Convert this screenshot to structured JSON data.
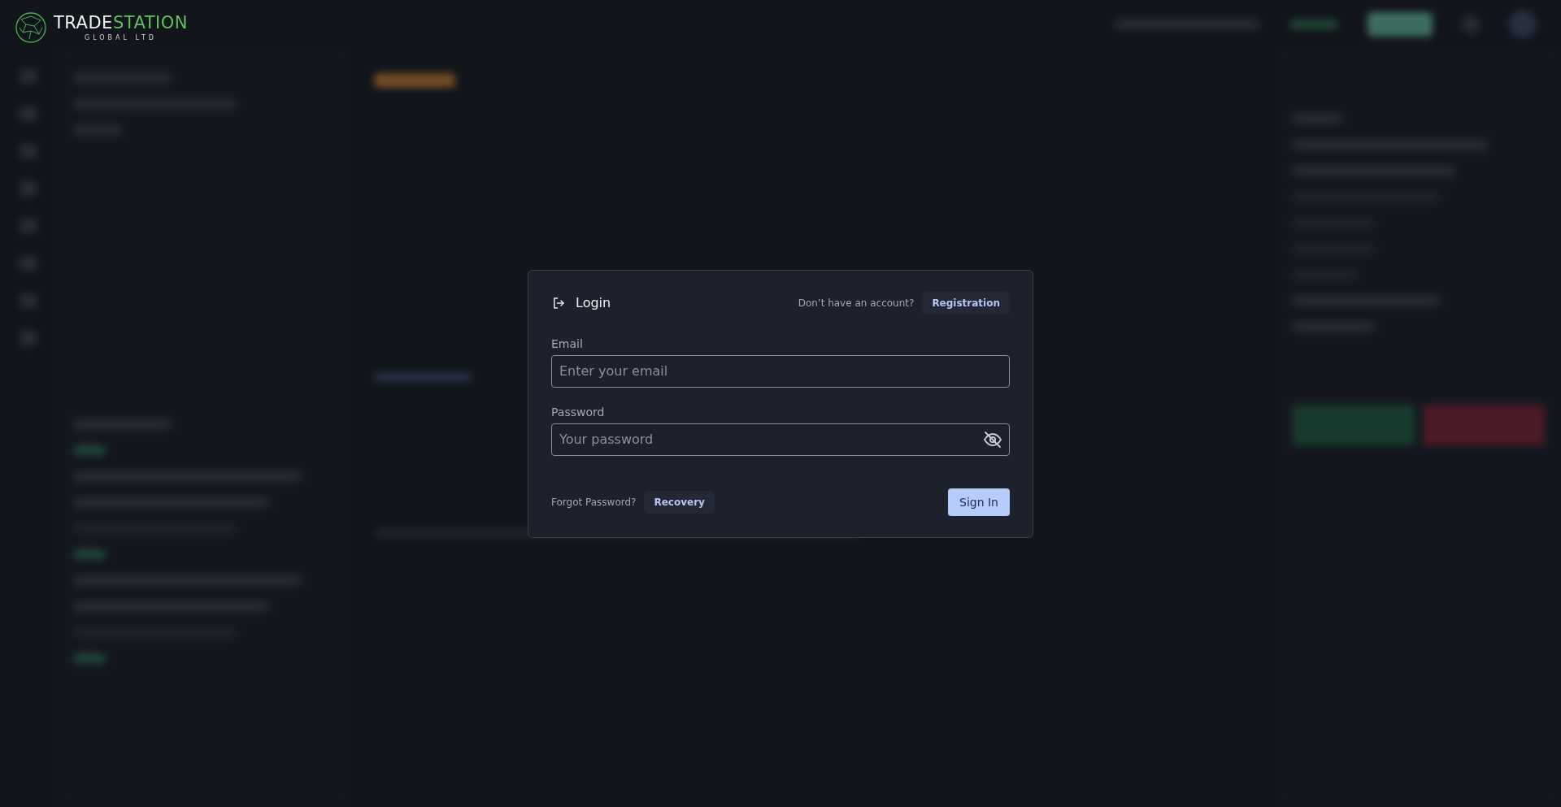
{
  "logo": {
    "name_part_1": "TRADE",
    "name_part_2": "STATION",
    "tagline": "GLOBAL LTD"
  },
  "login_dialog": {
    "title": "Login",
    "account_prompt": "Don’t have an account?",
    "registration_button": "Registration",
    "fields": [
      {
        "label": "Email",
        "placeholder": "Enter your email",
        "kind": "text"
      },
      {
        "label": "Password",
        "placeholder": "Your password",
        "kind": "password"
      }
    ],
    "forgot_prompt": "Forgot Password?",
    "recovery_button": "Recovery",
    "sign_in_button": "Sign In"
  }
}
